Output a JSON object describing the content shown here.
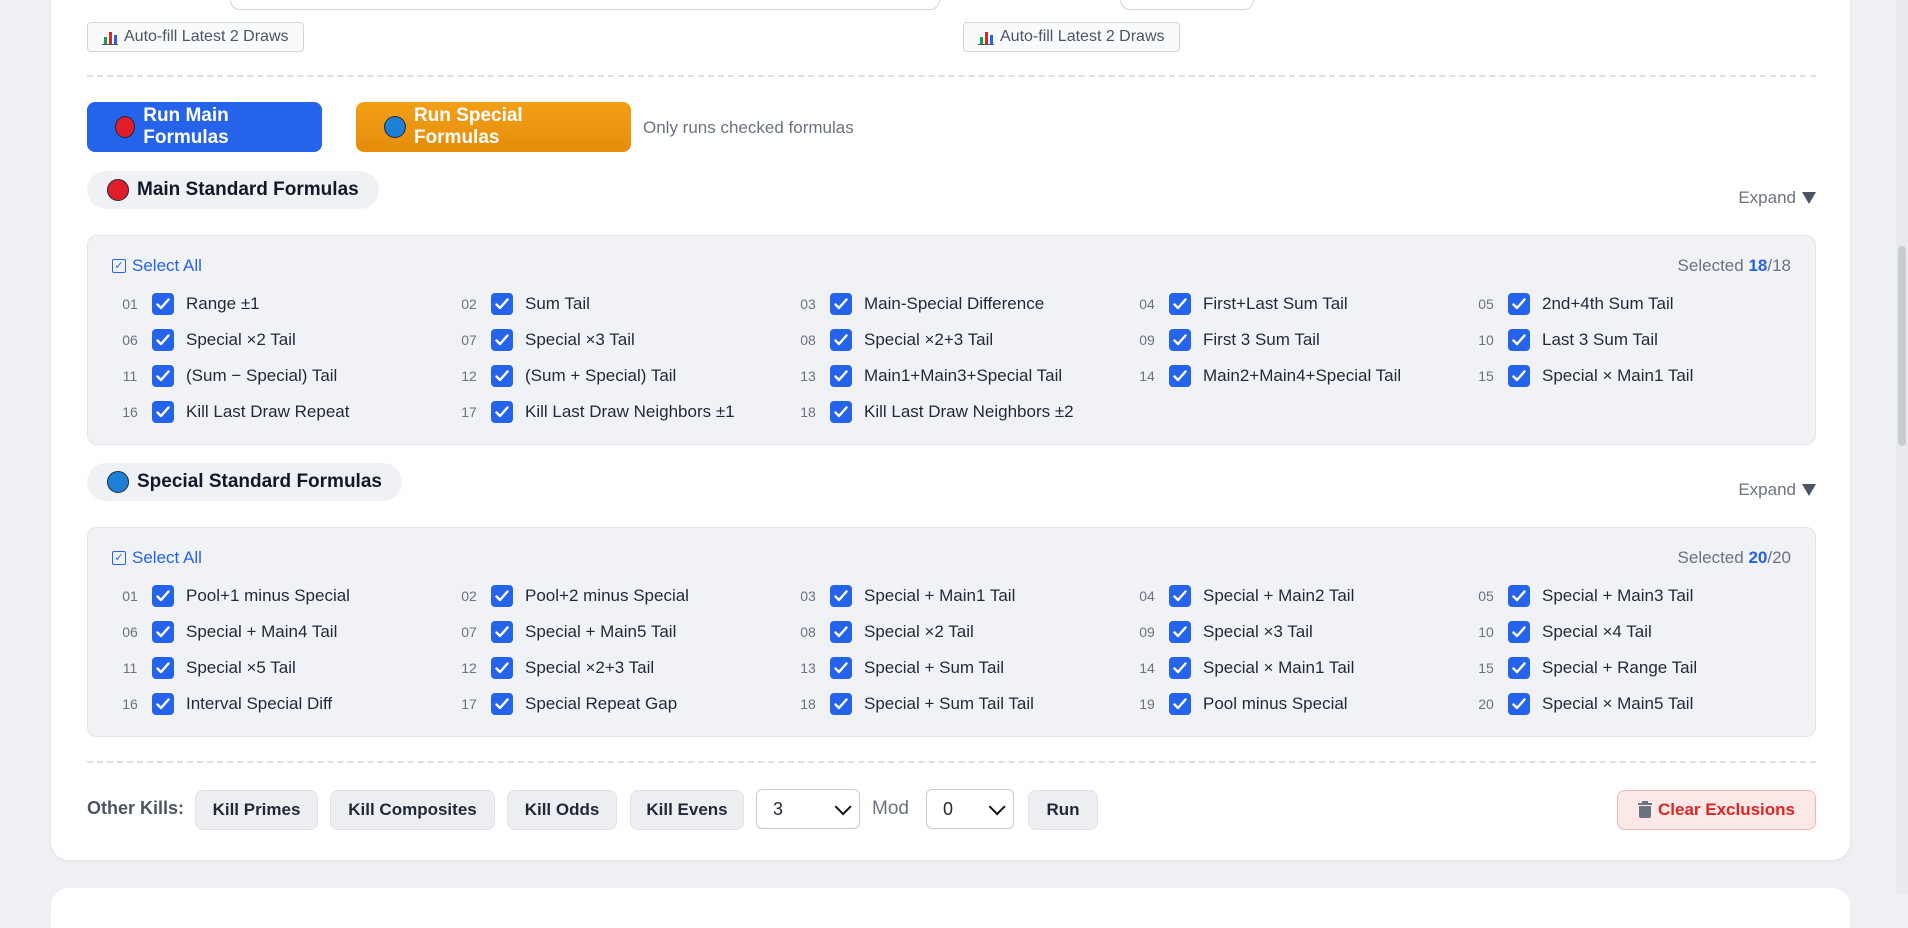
{
  "autofill": {
    "left_label": "Auto-fill Latest 2 Draws",
    "right_label": "Auto-fill Latest 2 Draws"
  },
  "actions": {
    "run_main_label": "Run Main Formulas",
    "run_special_label": "Run Special Formulas",
    "hint": "Only runs checked formulas"
  },
  "main_section": {
    "title": "Main Standard Formulas",
    "expand_label": "Expand",
    "select_all_label": "Select All",
    "selected_prefix": "Selected ",
    "selected_count": "18",
    "selected_total": "/18",
    "items": [
      {
        "num": "01",
        "label": "Range ±1",
        "checked": true
      },
      {
        "num": "02",
        "label": "Sum Tail",
        "checked": true
      },
      {
        "num": "03",
        "label": "Main-Special Difference",
        "checked": true
      },
      {
        "num": "04",
        "label": "First+Last Sum Tail",
        "checked": true
      },
      {
        "num": "05",
        "label": "2nd+4th Sum Tail",
        "checked": true
      },
      {
        "num": "06",
        "label": "Special ×2 Tail",
        "checked": true
      },
      {
        "num": "07",
        "label": "Special ×3 Tail",
        "checked": true
      },
      {
        "num": "08",
        "label": "Special ×2+3 Tail",
        "checked": true
      },
      {
        "num": "09",
        "label": "First 3 Sum Tail",
        "checked": true
      },
      {
        "num": "10",
        "label": "Last 3 Sum Tail",
        "checked": true
      },
      {
        "num": "11",
        "label": "(Sum − Special) Tail",
        "checked": true
      },
      {
        "num": "12",
        "label": "(Sum + Special) Tail",
        "checked": true
      },
      {
        "num": "13",
        "label": "Main1+Main3+Special Tail",
        "checked": true
      },
      {
        "num": "14",
        "label": "Main2+Main4+Special Tail",
        "checked": true
      },
      {
        "num": "15",
        "label": "Special × Main1 Tail",
        "checked": true
      },
      {
        "num": "16",
        "label": "Kill Last Draw Repeat",
        "checked": true
      },
      {
        "num": "17",
        "label": "Kill Last Draw Neighbors ±1",
        "checked": true
      },
      {
        "num": "18",
        "label": "Kill Last Draw Neighbors ±2",
        "checked": true
      }
    ]
  },
  "special_section": {
    "title": "Special Standard Formulas",
    "expand_label": "Expand",
    "select_all_label": "Select All",
    "selected_prefix": "Selected ",
    "selected_count": "20",
    "selected_total": "/20",
    "items": [
      {
        "num": "01",
        "label": "Pool+1 minus Special",
        "checked": true
      },
      {
        "num": "02",
        "label": "Pool+2 minus Special",
        "checked": true
      },
      {
        "num": "03",
        "label": "Special + Main1 Tail",
        "checked": true
      },
      {
        "num": "04",
        "label": "Special + Main2 Tail",
        "checked": true
      },
      {
        "num": "05",
        "label": "Special + Main3 Tail",
        "checked": true
      },
      {
        "num": "06",
        "label": "Special + Main4 Tail",
        "checked": true
      },
      {
        "num": "07",
        "label": "Special + Main5 Tail",
        "checked": true
      },
      {
        "num": "08",
        "label": "Special ×2 Tail",
        "checked": true
      },
      {
        "num": "09",
        "label": "Special ×3 Tail",
        "checked": true
      },
      {
        "num": "10",
        "label": "Special ×4 Tail",
        "checked": true
      },
      {
        "num": "11",
        "label": "Special ×5 Tail",
        "checked": true
      },
      {
        "num": "12",
        "label": "Special ×2+3 Tail",
        "checked": true
      },
      {
        "num": "13",
        "label": "Special + Sum Tail",
        "checked": true
      },
      {
        "num": "14",
        "label": "Special × Main1 Tail",
        "checked": true
      },
      {
        "num": "15",
        "label": "Special + Range Tail",
        "checked": true
      },
      {
        "num": "16",
        "label": "Interval Special Diff",
        "checked": true
      },
      {
        "num": "17",
        "label": "Special Repeat Gap",
        "checked": true
      },
      {
        "num": "18",
        "label": "Special + Sum Tail Tail",
        "checked": true
      },
      {
        "num": "19",
        "label": "Pool minus Special",
        "checked": true
      },
      {
        "num": "20",
        "label": "Special × Main5 Tail",
        "checked": true
      }
    ]
  },
  "other_kills": {
    "label": "Other Kills:",
    "kill_primes": "Kill Primes",
    "kill_composites": "Kill Composites",
    "kill_odds": "Kill Odds",
    "kill_evens": "Kill Evens",
    "modulus_value": "3",
    "mod_label": "Mod",
    "remainder_value": "0",
    "run_label": "Run",
    "clear_label": "Clear Exclusions"
  },
  "colors": {
    "primary_blue": "#2563eb",
    "special_orange": "#ef9a12",
    "main_ball": "#e11d2a",
    "special_ball": "#1d7fd6",
    "danger_red": "#dc2626"
  }
}
